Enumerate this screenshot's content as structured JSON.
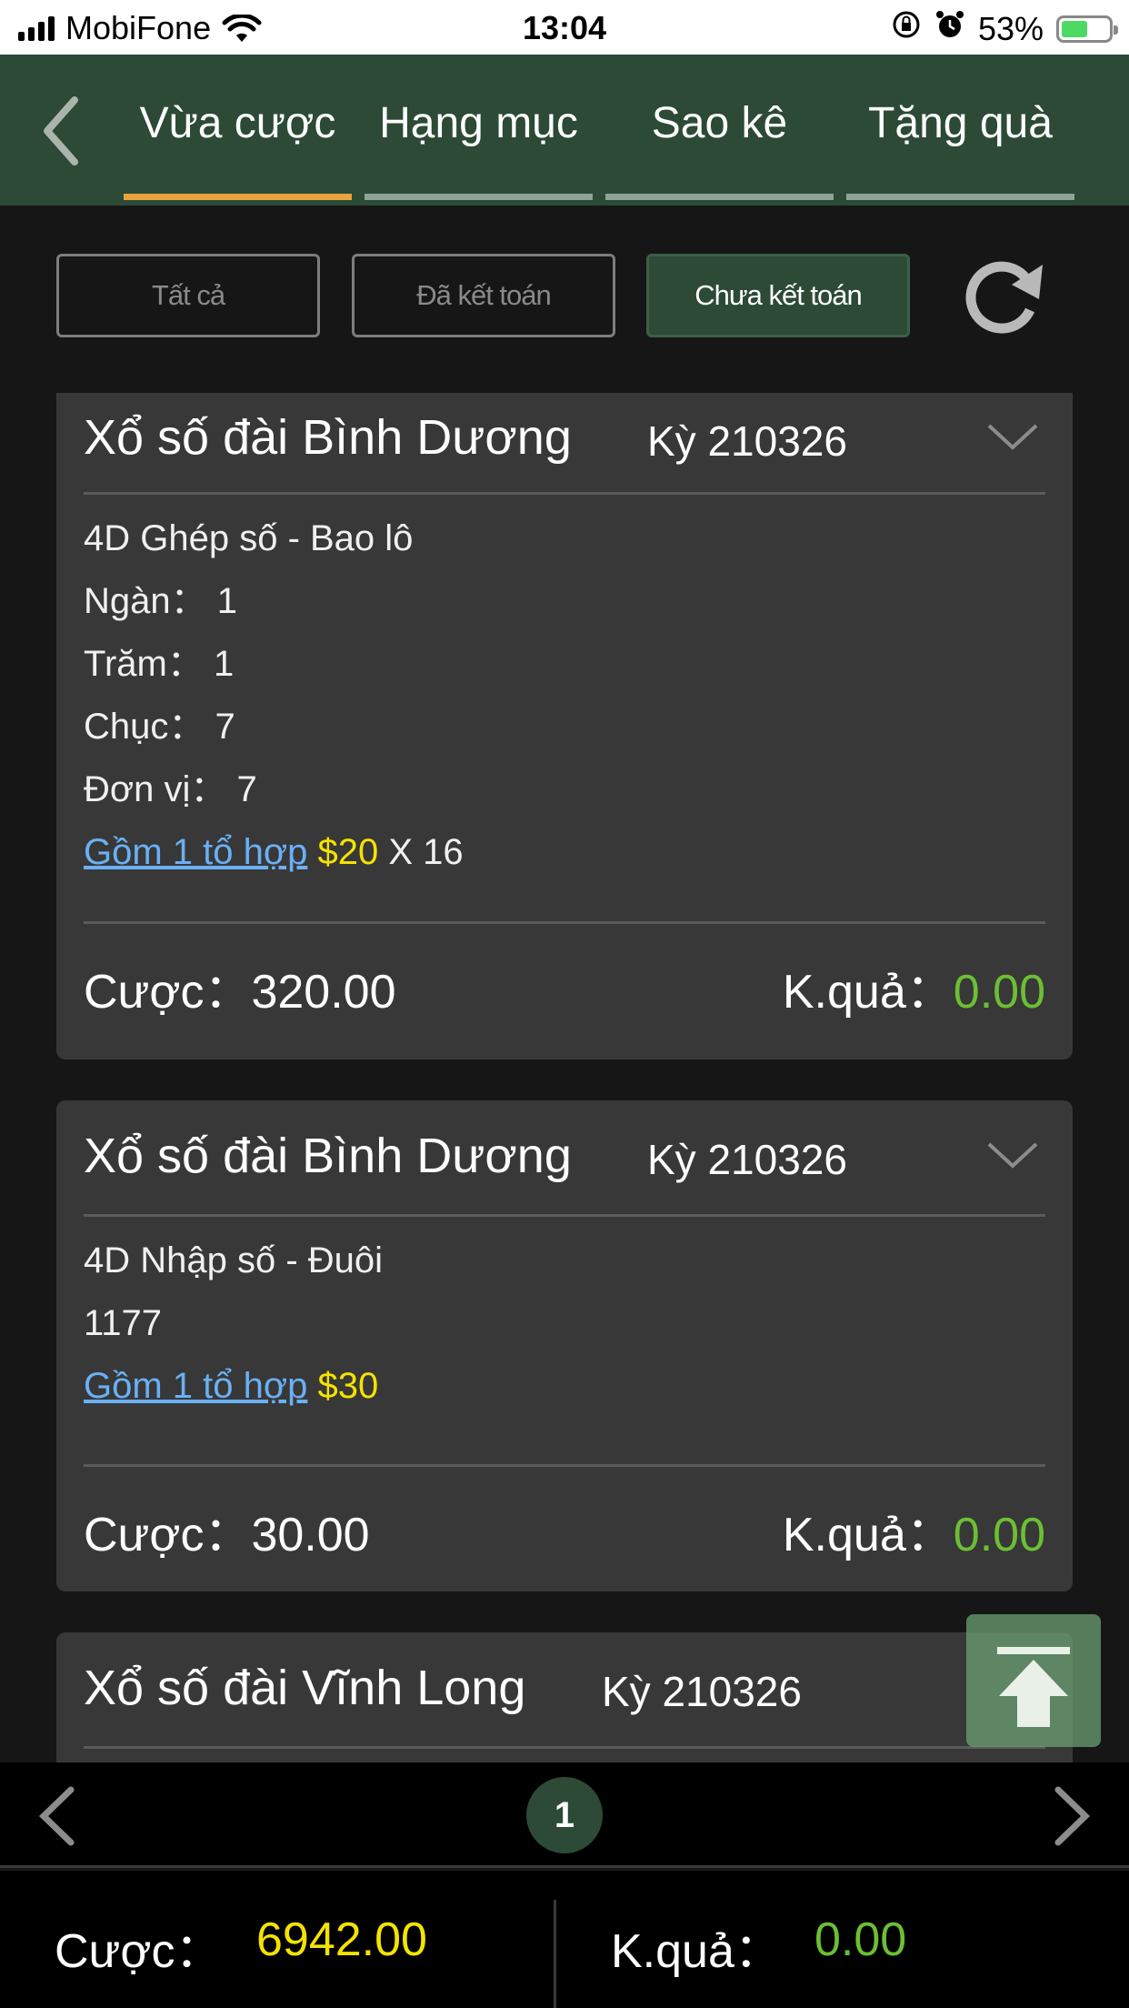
{
  "status_bar": {
    "carrier": "MobiFone",
    "time": "13:04",
    "battery": "53%"
  },
  "header": {
    "tabs": [
      {
        "label": "Vừa cược",
        "active": true
      },
      {
        "label": "Hạng mục",
        "active": false
      },
      {
        "label": "Sao kê",
        "active": false
      },
      {
        "label": "Tặng quà",
        "active": false
      }
    ]
  },
  "filters": {
    "all": "Tất cả",
    "settled": "Đã kết toán",
    "unsettled": "Chưa kết toán",
    "active": "unsettled"
  },
  "cards": [
    {
      "title": "Xổ số đài Bình Dương",
      "period": "Kỳ 210326",
      "bet_type": "4D Ghép số - Bao lô",
      "details": [
        "Ngàn： 1",
        "Trăm： 1",
        "Chục： 7",
        "Đơn vị： 7"
      ],
      "combo_link": "Gồm 1 tổ hợp",
      "combo_amount": "$20",
      "combo_multiplier": " X 16",
      "bet_label": "Cược：",
      "bet_value": "320.00",
      "result_label": "K.quả：",
      "result_value": "0.00"
    },
    {
      "title": "Xổ số đài Bình Dương",
      "period": "Kỳ 210326",
      "bet_type": "4D Nhập số - Đuôi",
      "details": [
        "1177"
      ],
      "combo_link": "Gồm 1 tổ hợp",
      "combo_amount": "$30",
      "bet_label": "Cược：",
      "bet_value": "30.00",
      "result_label": "K.quả：",
      "result_value": "0.00"
    },
    {
      "title": "Xổ số đài Vĩnh Long",
      "period": "Kỳ 210326"
    }
  ],
  "pager": {
    "current_page": "1"
  },
  "totals": {
    "bet_label": "Cược：",
    "bet_value": "6942.00",
    "result_label": "K.quả：",
    "result_value": "0.00"
  },
  "colors": {
    "header_bg": "#2c4a36",
    "tab_active_underline": "#e9a33c",
    "money": "#f4e300",
    "result": "#6cbf34",
    "link": "#6ab0f5"
  },
  "icons": {
    "back": "chevron-left-icon",
    "refresh": "refresh-icon",
    "expand": "chevron-down-icon",
    "scroll_top": "arrow-up-icon",
    "prev": "chevron-left-icon",
    "next": "chevron-right-icon"
  }
}
